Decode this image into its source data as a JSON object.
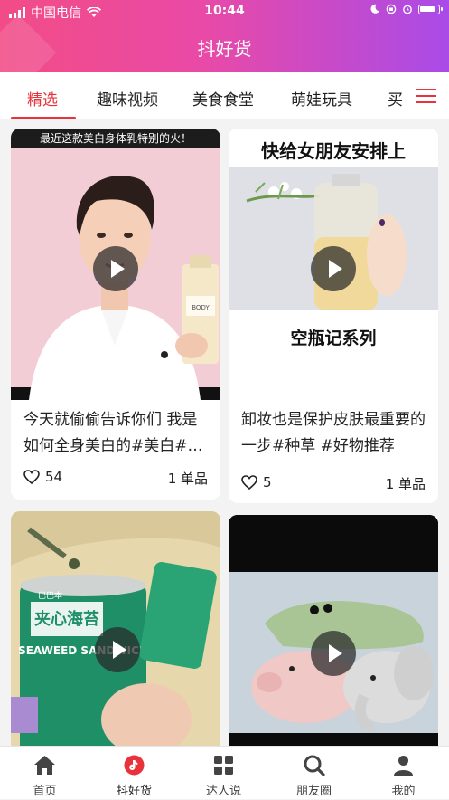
{
  "status_bar": {
    "carrier": "中国电信",
    "time": "10:44"
  },
  "header": {
    "title": "抖好货"
  },
  "tabs": [
    {
      "label": "精选",
      "active": true
    },
    {
      "label": "趣味视频",
      "active": false
    },
    {
      "label": "美食食堂",
      "active": false
    },
    {
      "label": "萌娃玩具",
      "active": false
    },
    {
      "label": "买",
      "active": false
    }
  ],
  "cards": [
    {
      "overlay_text": "最近这款美白身体乳特别的火！",
      "product_label": "BODY",
      "description": "今天就偷偷告诉你们 我是如何全身美白的#美白#…",
      "likes": "54",
      "items": "1 单品"
    },
    {
      "overlay_top": "快给女朋友安排上",
      "overlay_bottom": "空瓶记系列",
      "description": "卸妆也是保护皮肤最重要的一步#种草 #好物推荐",
      "likes": "5",
      "items": "1 单品"
    },
    {
      "product_label": "SEAWEED SANDWICH",
      "brand": "巴巴本",
      "product_cn": "夹心海苔"
    },
    {}
  ],
  "bottom_nav": [
    {
      "label": "首页",
      "icon": "home-icon"
    },
    {
      "label": "抖好货",
      "icon": "tiktok-icon",
      "active": true
    },
    {
      "label": "达人说",
      "icon": "grid-icon"
    },
    {
      "label": "朋友圈",
      "icon": "search-icon"
    },
    {
      "label": "我的",
      "icon": "person-icon"
    }
  ],
  "colors": {
    "accent": "#e8323c",
    "header_start": "#f24c86",
    "header_end": "#a94be8"
  }
}
